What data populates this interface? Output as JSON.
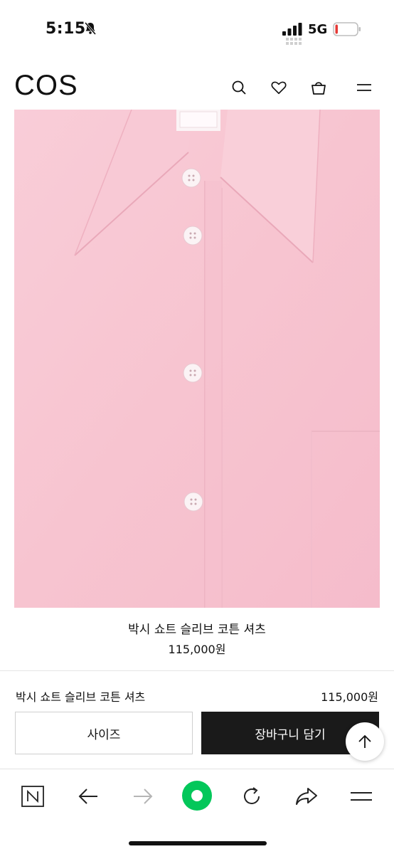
{
  "status_bar": {
    "time": "5:15",
    "network": "5G",
    "battery_level": 0.12,
    "battery_color": "#e53935",
    "icons": [
      "bell-slash-icon",
      "signal-icon",
      "battery-icon"
    ]
  },
  "header": {
    "logo": "COS",
    "icons": [
      "search-icon",
      "heart-icon",
      "shopping-bag-icon",
      "menu-icon"
    ]
  },
  "product": {
    "image_description_icon": "pink-shirt-image",
    "title": "박시 쇼트 슬리브 코튼 셔츠",
    "price": "115,000원",
    "image_color": "#f7c6d2"
  },
  "sticky_bar": {
    "name": "박시 쇼트 슬리브 코튼 셔츠",
    "price": "115,000원",
    "size_label": "사이즈",
    "cart_label": "장바구니 담기",
    "cart_color": "#1a1a1a"
  },
  "browser_toolbar": {
    "icons": [
      "naver-n-icon",
      "back-arrow-icon",
      "forward-arrow-icon",
      "green-home-button",
      "reload-icon",
      "share-icon",
      "menu-icon"
    ],
    "accent": "#03c75a"
  }
}
